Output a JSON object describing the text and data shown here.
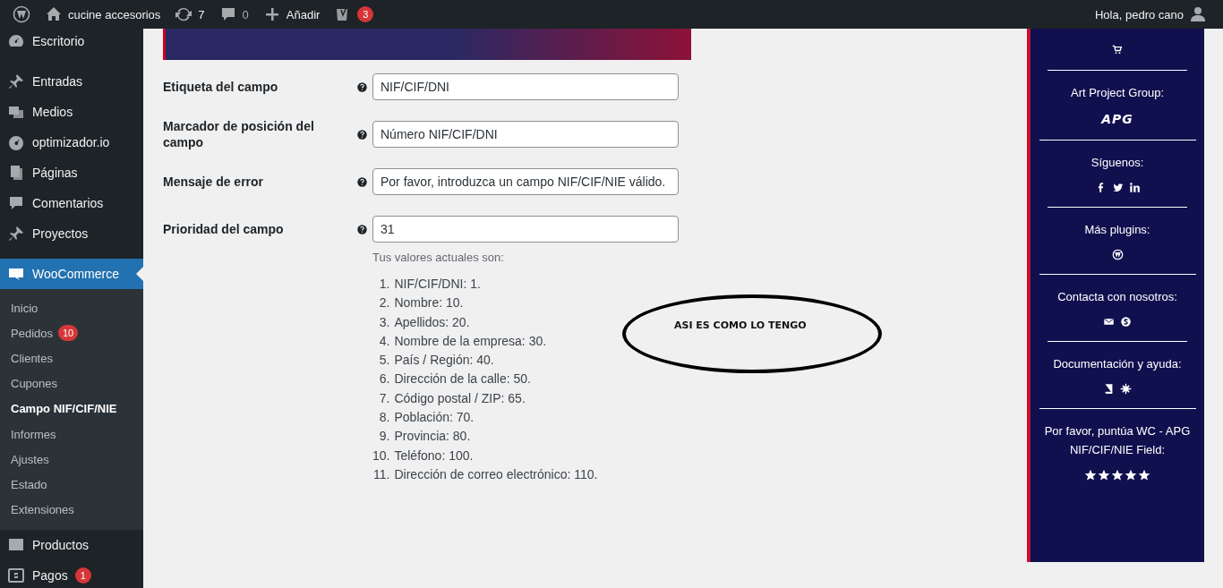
{
  "admin_bar": {
    "site_name": "cucine accesorios",
    "updates_count": "7",
    "comments_count": "0",
    "add_label": "Añadir",
    "seo_badge": "3",
    "greeting": "Hola, pedro cano"
  },
  "sidebar": {
    "items": [
      {
        "label": "Escritorio",
        "selected": false
      },
      {
        "label": "Entradas",
        "selected": false
      },
      {
        "label": "Medios",
        "selected": false
      },
      {
        "label": "optimizador.io",
        "selected": false
      },
      {
        "label": "Páginas",
        "selected": false
      },
      {
        "label": "Comentarios",
        "selected": false
      },
      {
        "label": "Proyectos",
        "selected": false
      },
      {
        "label": "WooCommerce",
        "selected": true,
        "children": [
          {
            "label": "Inicio",
            "selected": false
          },
          {
            "label": "Pedidos",
            "selected": false,
            "badge": "10"
          },
          {
            "label": "Clientes",
            "selected": false
          },
          {
            "label": "Cupones",
            "selected": false
          },
          {
            "label": "Campo NIF/CIF/NIE",
            "selected": true
          },
          {
            "label": "Informes",
            "selected": false
          },
          {
            "label": "Ajustes",
            "selected": false
          },
          {
            "label": "Estado",
            "selected": false
          },
          {
            "label": "Extensiones",
            "selected": false
          }
        ]
      },
      {
        "label": "Productos",
        "selected": false
      },
      {
        "label": "Pagos",
        "selected": false,
        "badge": "1"
      }
    ]
  },
  "form": {
    "fields": [
      {
        "label": "Etiqueta del campo",
        "value": "NIF/CIF/DNI"
      },
      {
        "label": "Marcador de posición del campo",
        "value": "Número NIF/CIF/DNI"
      },
      {
        "label": "Mensaje de error",
        "value": "Por favor, introduzca un campo NIF/CIF/NIE válido."
      },
      {
        "label": "Prioridad del campo",
        "value": "31"
      }
    ],
    "hint": "Tus valores actuales son:",
    "priorities": [
      {
        "number": "1.",
        "text": "NIF/CIF/DNI: 1."
      },
      {
        "number": "2.",
        "text": "Nombre: 10."
      },
      {
        "number": "3.",
        "text": "Apellidos: 20."
      },
      {
        "number": "4.",
        "text": "Nombre de la empresa: 30."
      },
      {
        "number": "5.",
        "text": "País / Región: 40."
      },
      {
        "number": "6.",
        "text": "Dirección de la calle: 50."
      },
      {
        "number": "7.",
        "text": "Código postal / ZIP: 65."
      },
      {
        "number": "8.",
        "text": "Población: 70."
      },
      {
        "number": "9.",
        "text": "Provincia: 80."
      },
      {
        "number": "10.",
        "text": "Teléfono: 100."
      },
      {
        "number": "11.",
        "text": "Dirección de correo electrónico: 110."
      }
    ]
  },
  "annotation": {
    "text": "ASI ES COMO LO TENGO"
  },
  "side_panel": {
    "sections": [
      {
        "kind": "icons"
      },
      {
        "kind": "logo",
        "title": "Art Project Group:",
        "logo": "APG"
      },
      {
        "kind": "icons",
        "title": "Síguenos:"
      },
      {
        "kind": "icons",
        "title": "Más plugins:"
      },
      {
        "kind": "icons",
        "title": "Contacta con nosotros:"
      },
      {
        "kind": "icons",
        "title": "Documentación y ayuda:"
      },
      {
        "kind": "rating",
        "title": "Por favor, puntúa WC - APG NIF/CIF/NIE Field:",
        "stars": 5
      }
    ]
  }
}
